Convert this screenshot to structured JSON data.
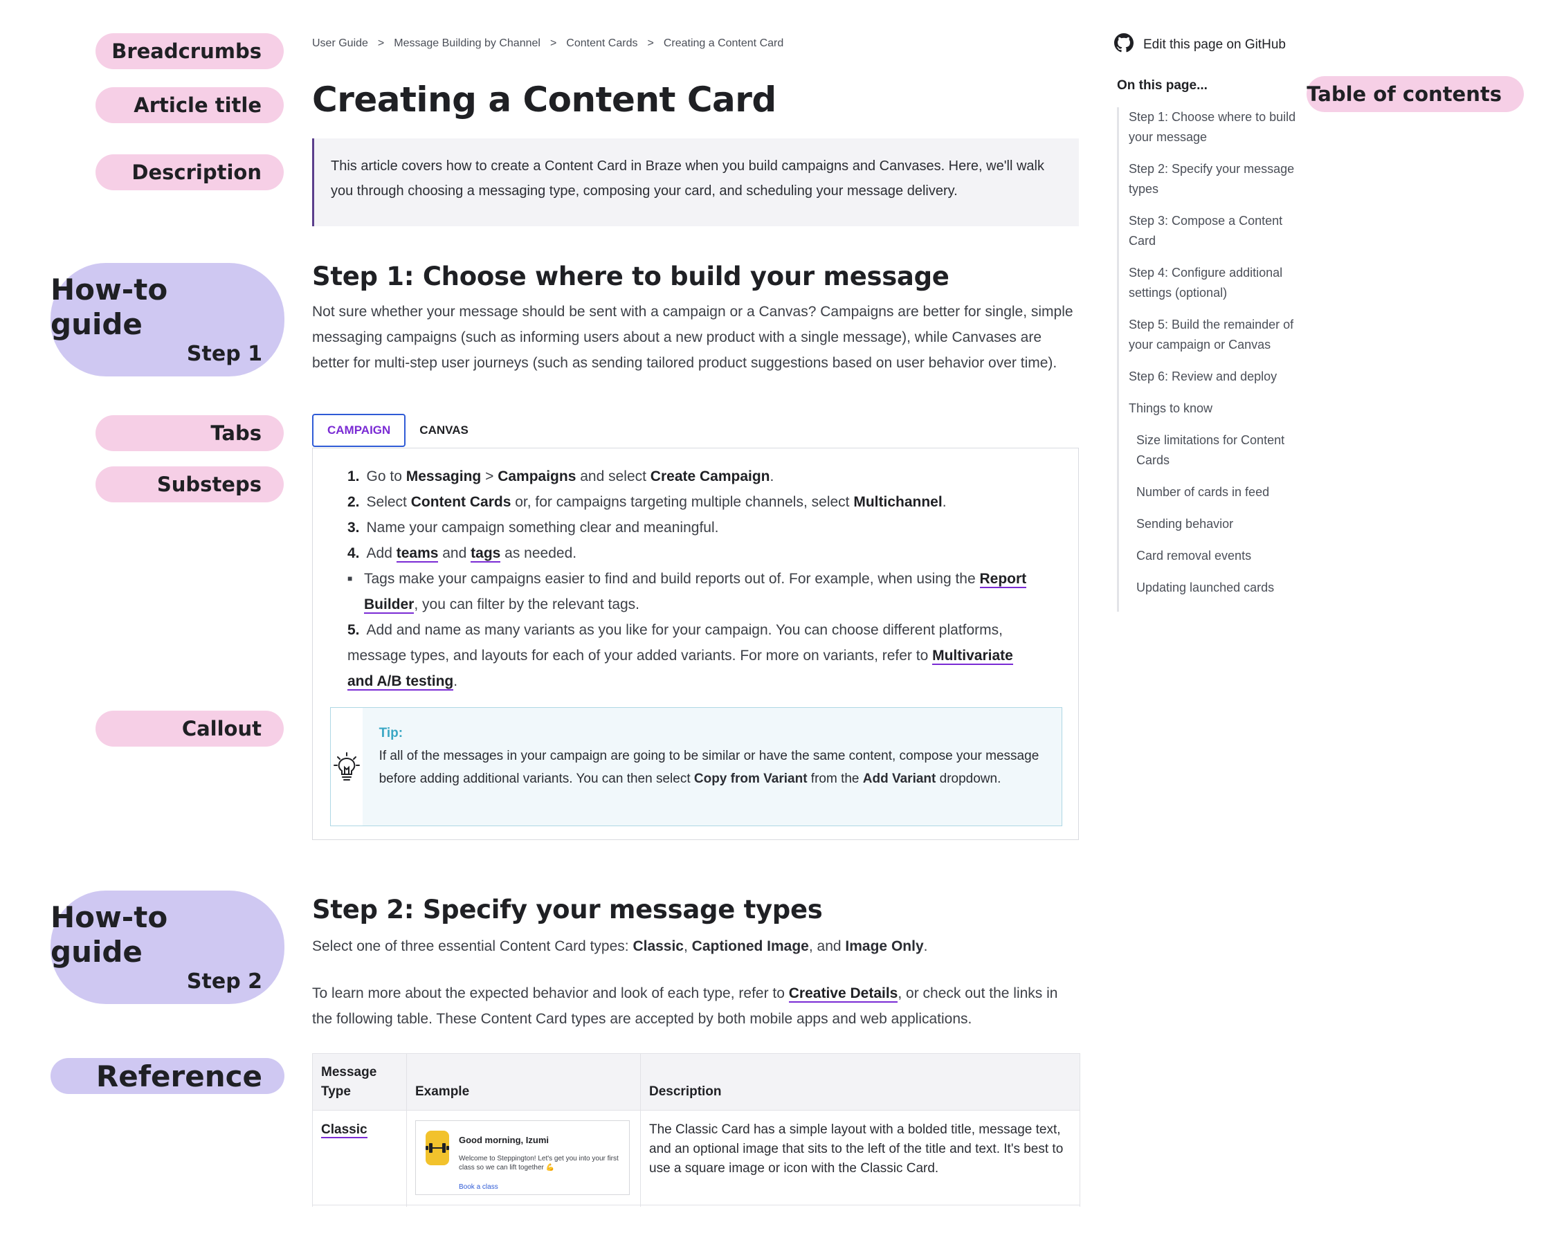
{
  "annotations": {
    "breadcrumbs": "Breadcrumbs",
    "article_title": "Article title",
    "description": "Description",
    "howto1_main": "How-to guide",
    "howto1_step": "Step 1",
    "tabs": "Tabs",
    "substeps": "Substeps",
    "callout": "Callout",
    "howto2_main": "How-to guide",
    "howto2_step": "Step 2",
    "reference": "Reference",
    "toc": "Table of contents"
  },
  "breadcrumb": [
    "User Guide",
    "Message Building by Channel",
    "Content Cards",
    "Creating a Content Card"
  ],
  "breadcrumb_sep": ">",
  "title": "Creating a Content Card",
  "description": "This article covers how to create a Content Card in Braze when you build campaigns and Canvases. Here, we'll walk you through choosing a messaging type, composing your card, and scheduling your message delivery.",
  "step1": {
    "heading": "Step 1: Choose where to build your message",
    "intro": "Not sure whether your message should be sent with a campaign or a Canvas? Campaigns are better for single, simple messaging campaigns (such as informing users about a new product with a single message), while Canvases are better for multi-step user journeys (such as sending tailored product suggestions based on user behavior over time).",
    "tabs": [
      "CAMPAIGN",
      "CANVAS"
    ],
    "items": {
      "n1": "1.",
      "i1a": "Go to ",
      "i1b": "Messaging",
      "i1c": " > ",
      "i1d": "Campaigns",
      "i1e": " and select ",
      "i1f": "Create Campaign",
      "i1g": ".",
      "n2": "2.",
      "i2a": "Select ",
      "i2b": "Content Cards",
      "i2c": " or, for campaigns targeting multiple channels, select ",
      "i2d": "Multichannel",
      "i2e": ".",
      "n3": "3.",
      "i3": "Name your campaign something clear and meaningful.",
      "n4": "4.",
      "i4a": "Add ",
      "i4b": "teams",
      "i4c": " and ",
      "i4d": "tags",
      "i4e": " as needed.",
      "bullet_a": "Tags make your campaigns easier to find and build reports out of. For example, when using the ",
      "bullet_link": "Report Builder",
      "bullet_b": ", you can filter by the relevant tags.",
      "n5": "5.",
      "i5a": "Add and name as many variants as you like for your campaign. You can choose different platforms, message types, and layouts for each of your added variants. For more on variants, refer to ",
      "i5link": "Multivariate and A/B testing",
      "i5b": "."
    },
    "tip": {
      "label": "Tip:",
      "text_a": "If all of the messages in your campaign are going to be similar or have the same content, compose your message before adding additional variants. You can then select ",
      "bold1": "Copy from Variant",
      "text_b": " from the ",
      "bold2": "Add Variant",
      "text_c": " dropdown."
    }
  },
  "step2": {
    "heading": "Step 2: Specify your message types",
    "p1a": "Select one of three essential Content Card types: ",
    "p1b": "Classic",
    "p1c": ", ",
    "p1d": "Captioned Image",
    "p1e": ", and ",
    "p1f": "Image Only",
    "p1g": ".",
    "p2a": "To learn more about the expected behavior and look of each type, refer to ",
    "p2link": "Creative Details",
    "p2b": ", or check out the links in the following table. These Content Card types are accepted by both mobile apps and web applications.",
    "table": {
      "headers": [
        "Message Type",
        "Example",
        "Description"
      ],
      "row1": {
        "type": "Classic",
        "example_title": "Good morning, Izumi",
        "example_text": "Welcome to Steppington! Let's get you into your first class so we can lift together 💪",
        "example_link": "Book a class",
        "description": "The Classic Card has a simple layout with a bolded title, message text, and an optional image that sits to the left of the title and text. It's best to use a square image or icon with the Classic Card."
      }
    }
  },
  "sidebar": {
    "github": "Edit this page on GitHub",
    "toc_heading": "On this page...",
    "toc": [
      "Step 1: Choose where to build your message",
      "Step 2: Specify your message types",
      "Step 3: Compose a Content Card",
      "Step 4: Configure additional settings (optional)",
      "Step 5: Build the remainder of your campaign or Canvas",
      "Step 6: Review and deploy",
      "Things to know",
      "Size limitations for Content Cards",
      "Number of cards in feed",
      "Sending behavior",
      "Card removal events",
      "Updating launched cards"
    ]
  },
  "colors": {
    "pink_pill": "#f6cfe6",
    "lavender_pill": "#cfc8f2",
    "link_underline": "#7a2bd4",
    "active_tab_border": "#2f5bd6",
    "tip_accent": "#3aa7c4"
  }
}
